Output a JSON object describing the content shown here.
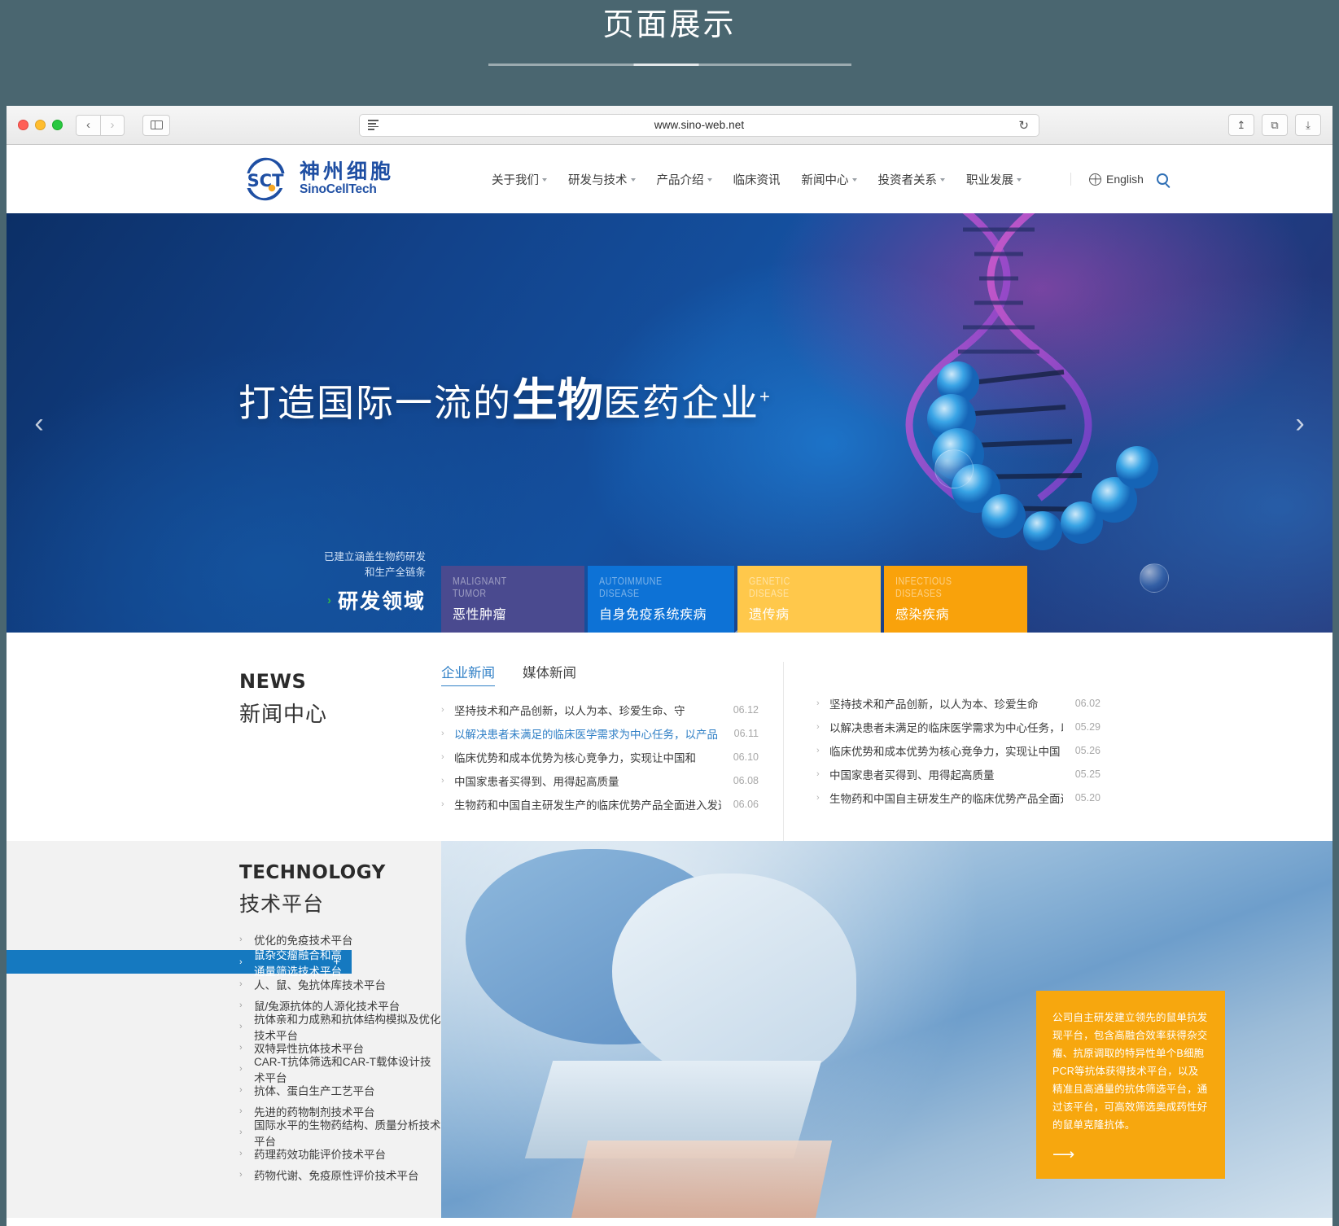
{
  "page": {
    "heading": "页面展示"
  },
  "browser": {
    "url": "www.sino-web.net",
    "back_label": "‹",
    "forward_label": "›",
    "reload_label": "↻",
    "share_label": "↥",
    "tabs_label": "⧉",
    "downloads_label": "⤓"
  },
  "site": {
    "logo": {
      "mark": "SCT",
      "name_cn": "神州细胞",
      "name_en": "SinoCellTech"
    },
    "nav": [
      {
        "label": "关于我们",
        "has_dropdown": true
      },
      {
        "label": "研发与技术",
        "has_dropdown": true
      },
      {
        "label": "产品介绍",
        "has_dropdown": true
      },
      {
        "label": "临床资讯",
        "has_dropdown": false
      },
      {
        "label": "新闻中心",
        "has_dropdown": true
      },
      {
        "label": "投资者关系",
        "has_dropdown": true
      },
      {
        "label": "职业发展",
        "has_dropdown": true
      }
    ],
    "language": "English",
    "search_icon": "search-icon"
  },
  "hero": {
    "title_prefix": "打造国际一流的",
    "title_strong": "生物",
    "title_suffix": "医药企业",
    "title_sup": "+",
    "prev_arrow": "‹",
    "next_arrow": "›",
    "caption_small_line1": "已建立涵盖生物药研发",
    "caption_small_line2": "和生产全链条",
    "caption_chevron": "›",
    "caption_big": "研发领域",
    "tiles": [
      {
        "en_line1": "MALIGNANT",
        "en_line2": "TUMOR",
        "cn": "恶性肿瘤",
        "color": "#4a4a8f"
      },
      {
        "en_line1": "AUTOIMMUNE",
        "en_line2": "DISEASE",
        "cn": "自身免疫系统疾病",
        "color": "#0d72d6"
      },
      {
        "en_line1": "GENETIC",
        "en_line2": "DISEASE",
        "cn": "遗传病",
        "color": "#ffc84b"
      },
      {
        "en_line1": "INFECTIOUS",
        "en_line2": "DISEASES",
        "cn": "感染疾病",
        "color": "#f9a20b"
      }
    ]
  },
  "news": {
    "title_en": "NEWS",
    "title_cn": "新闻中心",
    "tabs": [
      {
        "label": "企业新闻",
        "active": true
      },
      {
        "label": "媒体新闻",
        "active": false
      }
    ],
    "column_left": [
      {
        "text": "坚持技术和产品创新，以人为本、珍爱生命、守",
        "date": "06.12",
        "highlight": false
      },
      {
        "text": "以解决患者未满足的临床医学需求为中心任务，以产品",
        "date": "06.11",
        "highlight": true
      },
      {
        "text": "临床优势和成本优势为核心竞争力，实现让中国和",
        "date": "06.10",
        "highlight": false
      },
      {
        "text": "中国家患者买得到、用得起高质量",
        "date": "06.08",
        "highlight": false
      },
      {
        "text": "生物药和中国自主研发生产的临床优势产品全面进入发达国",
        "date": "06.06",
        "highlight": false
      }
    ],
    "column_right": [
      {
        "text": "坚持技术和产品创新，以人为本、珍爱生命",
        "date": "06.02",
        "highlight": false
      },
      {
        "text": "以解决患者未满足的临床医学需求为中心任务，以产",
        "date": "05.29",
        "highlight": false
      },
      {
        "text": "临床优势和成本优势为核心竞争力，实现让中国",
        "date": "05.26",
        "highlight": false
      },
      {
        "text": "中国家患者买得到、用得起高质量",
        "date": "05.25",
        "highlight": false
      },
      {
        "text": "生物药和中国自主研发生产的临床优势产品全面进入发",
        "date": "05.20",
        "highlight": false
      }
    ]
  },
  "technology": {
    "title_en": "TECHNOLOGY",
    "title_cn": "技术平台",
    "items": [
      {
        "label": "优化的免疫技术平台",
        "active": false
      },
      {
        "label": "鼠杂交瘤融合和高通量筛选技术平台",
        "active": true
      },
      {
        "label": "人、鼠、兔抗体库技术平台",
        "active": false
      },
      {
        "label": "鼠/兔源抗体的人源化技术平台",
        "active": false
      },
      {
        "label": "抗体亲和力成熟和抗体结构模拟及优化技术平台",
        "active": false
      },
      {
        "label": "双特异性抗体技术平台",
        "active": false
      },
      {
        "label": "CAR-T抗体筛选和CAR-T载体设计技术平台",
        "active": false
      },
      {
        "label": "抗体、蛋白生产工艺平台",
        "active": false
      },
      {
        "label": "先进的药物制剂技术平台",
        "active": false
      },
      {
        "label": "国际水平的生物药结构、质量分析技术平台",
        "active": false
      },
      {
        "label": "药理药效功能评价技术平台",
        "active": false
      },
      {
        "label": "药物代谢、免疫原性评价技术平台",
        "active": false
      }
    ],
    "active_plus": "+",
    "callout": "公司自主研发建立领先的鼠单抗发现平台，包含高融合效率获得杂交瘤、抗原调取的特异性单个B细胞PCR等抗体获得技术平台，以及精准且高通量的抗体筛选平台，通过该平台，可高效筛选奥成药性好的鼠单克隆抗体。",
    "callout_arrow": "⟶"
  },
  "colors": {
    "brand_blue": "#1579c0",
    "accent_orange": "#f7a70e",
    "link_blue": "#2f7fc6",
    "green": "#31b44b"
  }
}
